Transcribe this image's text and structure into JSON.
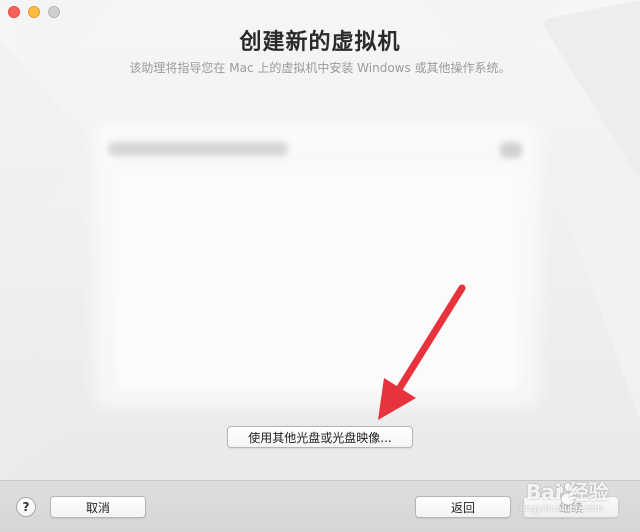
{
  "window": {
    "title": "创建新的虚拟机",
    "subtitle": "该助理将指导您在 Mac 上的虚拟机中安装 Windows 或其他操作系统。"
  },
  "main": {
    "other_disc_label": "使用其他光盘或光盘映像..."
  },
  "footer": {
    "help_label": "?",
    "cancel_label": "取消",
    "back_label": "返回",
    "continue_label": "继续"
  },
  "watermark": {
    "brand": "Bai 经验",
    "url": "jingyan.baidu.com"
  },
  "colors": {
    "close": "#fc605b",
    "minimize": "#fdbc40",
    "maximize": "#d0d0d0",
    "arrow": "#e8323c"
  },
  "icons": {
    "paw": "baidu-paw-icon",
    "arrow": "red-annotation-arrow"
  }
}
